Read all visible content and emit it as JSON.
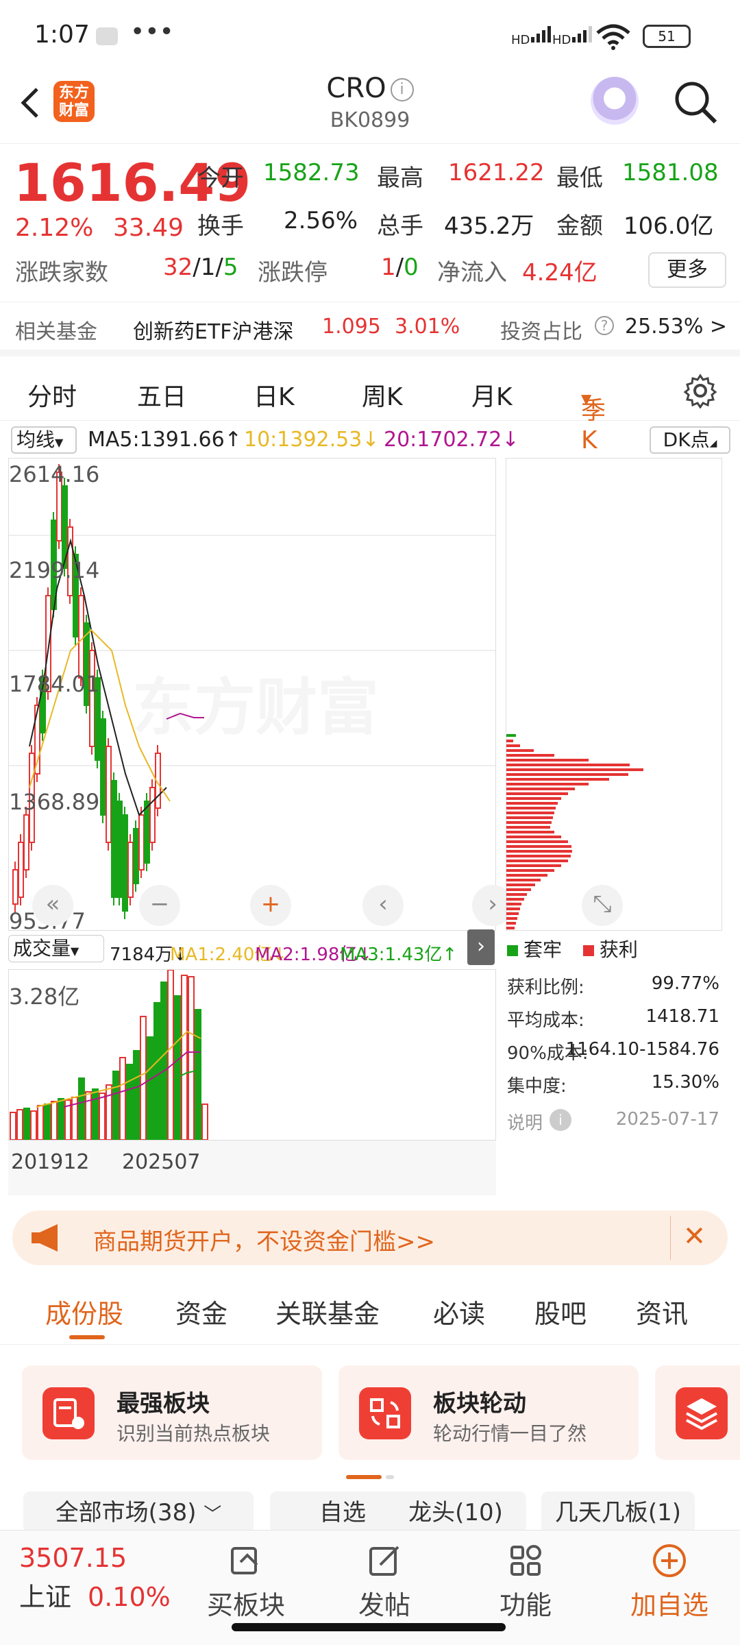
{
  "status": {
    "time": "1:07",
    "dots": "•••",
    "battery": "51",
    "sig1": "HD",
    "sig2": "HD"
  },
  "header": {
    "title": "CRO",
    "code": "BK0899",
    "logo": "东方财富"
  },
  "quote": {
    "price": "1616.49",
    "chg_pct": "2.12%",
    "chg_abs": "33.49",
    "open_label": "今开",
    "open": "1582.73",
    "high_label": "最高",
    "high": "1621.22",
    "low_label": "最低",
    "low": "1581.08",
    "turnover_label": "换手",
    "turnover": "2.56%",
    "volume_label": "总手",
    "volume": "435.2万",
    "amount_label": "金额",
    "amount": "106.0亿",
    "updown_label": "涨跌家数",
    "updown_up": "32",
    "updown_flat": "/1/",
    "updown_down": "5",
    "limit_label": "涨跌停",
    "limit_up": "1",
    "limit_sep": "/",
    "limit_down": "0",
    "inflow_label": "净流入",
    "inflow": "4.24亿",
    "more": "更多"
  },
  "fund": {
    "label": "相关基金",
    "name": "创新药ETF沪港深",
    "price": "1.095",
    "pct": "3.01%",
    "ratio_label": "投资占比",
    "ratio": "25.53% >"
  },
  "period_tabs": [
    "分时",
    "五日",
    "日K",
    "周K",
    "月K",
    "季K"
  ],
  "ma": {
    "select": "均线",
    "ma5": "MA5:1391.66",
    "ma10": "10:1392.53",
    "ma20": "20:1702.72",
    "dk": "DK点"
  },
  "kline_y": [
    "2614.16",
    "2199.14",
    "1784.01",
    "1368.89",
    "953.77"
  ],
  "volume": {
    "select": "成交量",
    "value": "7184万",
    "ma1": "MA1:2.40亿",
    "ma2": "MA2:1.98亿",
    "ma3": "MA3:1.43亿",
    "top": "3.28亿",
    "x_start": "201912",
    "x_end": "202507"
  },
  "chip": {
    "legend_trapped": "套牢",
    "legend_profit": "获利",
    "stats": [
      {
        "k": "获利比例:",
        "v": "99.77%"
      },
      {
        "k": "平均成本:",
        "v": "1418.71"
      },
      {
        "k": "90%成本:",
        "v": "1164.10-1584.76"
      },
      {
        "k": "集中度:",
        "v": "15.30%"
      }
    ],
    "note": "说明",
    "date": "2025-07-17"
  },
  "ad": {
    "text": "商品期货开户，不设资金门槛>>"
  },
  "sec_tabs": [
    "成份股",
    "资金",
    "关联基金",
    "必读",
    "股吧",
    "资讯"
  ],
  "cards": [
    {
      "title": "最强板块",
      "sub": "识别当前热点板块"
    },
    {
      "title": "板块轮动",
      "sub": "轮动行情一目了然"
    }
  ],
  "filters": [
    "全部市场(38)",
    "自选",
    "龙头(10)",
    "几天几板(1)"
  ],
  "bottom": {
    "index_value": "3507.15",
    "index_name": "上证",
    "index_pct": "0.10%",
    "buy": "买板块",
    "post": "发帖",
    "func": "功能",
    "add": "加自选"
  },
  "colors": {
    "up": "#e53333",
    "down": "#17a317",
    "accent": "#e0651d"
  },
  "chart_data": {
    "type": "candlestick",
    "y_ticks": [
      2614.16,
      2199.14,
      1784.01,
      1368.89,
      953.77
    ],
    "ma_series": [
      {
        "name": "MA5",
        "value": 1391.66
      },
      {
        "name": "MA10",
        "value": 1392.53
      },
      {
        "name": "MA20",
        "value": 1702.72
      }
    ]
  }
}
